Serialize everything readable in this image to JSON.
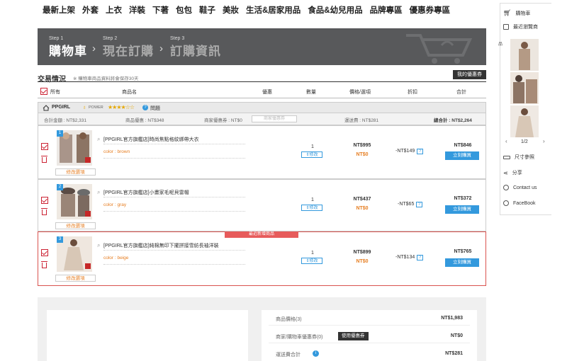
{
  "nav": [
    "最新上架",
    "外套",
    "上衣",
    "洋裝",
    "下著",
    "包包",
    "鞋子",
    "美妝",
    "生活&居家用品",
    "食品&幼兒用品",
    "品牌專區",
    "優惠券專區"
  ],
  "banner": {
    "step1_small": "Step 1",
    "step1": "購物車",
    "step2_small": "Step 2",
    "step2": "現在訂購",
    "step3_small": "Step 3",
    "step3": "訂購資訊",
    "arrow": "›"
  },
  "section": {
    "title": "交易情況",
    "note": "※ 購物車商品資料將會保存30天",
    "my_coupon": "我的優惠券"
  },
  "columns": {
    "all": "所有",
    "name": "商品名",
    "coupon": "優惠",
    "qty": "數量",
    "price": "價格/選項",
    "discount": "折扣",
    "total": "合計"
  },
  "shop": {
    "name": "PPGIRL",
    "power": "POWER",
    "stars": "★★★★☆☆",
    "question": "問題",
    "total_amount": "合計金額 : NT$2,331",
    "item_discount": "商品優惠 : NT$348",
    "shop_coupon": "商家優惠券 : NT$0",
    "coupon_placeholder": "商家優惠券",
    "shipping": "運送費 : NT$281",
    "grand_total": "總合計 : NT$2,264"
  },
  "items": [
    {
      "num": "1",
      "name": "[PPGIRL官方旗艦店]時尚焦點格紋綁帶大衣",
      "color": "color : brown",
      "qty": "1",
      "qty_btn": "⇕修改",
      "price": "NT$995",
      "price_opt": "NT$0",
      "discount": "-NT$149",
      "total": "NT$846",
      "buy": "立刻購買",
      "edit": "修改選項"
    },
    {
      "num": "2",
      "name": "[PPGIRL官方旗艦店]小畫家毛呢貝雷帽",
      "color": "color : gray",
      "qty": "1",
      "qty_btn": "⇕修改",
      "price": "NT$437",
      "price_opt": "NT$0",
      "discount": "-NT$65",
      "total": "NT$372",
      "buy": "立刻購買",
      "edit": "修改選項"
    },
    {
      "num": "3",
      "name": "[PPGIRL官方旗艦店]純棉無印下擺拼接雪紡長袖洋裝",
      "color": "color : beige",
      "qty": "1",
      "qty_btn": "⇕修改",
      "price": "NT$899",
      "price_opt": "NT$0",
      "discount": "-NT$134",
      "total": "NT$765",
      "buy": "立刻購買",
      "edit": "修改選項",
      "tag": "最近新增商品"
    }
  ],
  "summary": {
    "goods_label": "商品價格(3)",
    "goods_value": "NT$1,983",
    "coupon_label": "商家/購物車優惠券(0)",
    "coupon_btn": "使用優惠券",
    "coupon_value": "NT$0",
    "ship_label": "運送費合計",
    "ship_value": "NT$281"
  },
  "sidebar": {
    "cart": "購物車",
    "recent": "最近瀏覽商",
    "pager": "1/2",
    "prev": "‹",
    "next": "›",
    "size": "尺寸參照",
    "share": "分享",
    "contact": "Contact us",
    "facebook": "FaceBook",
    "edge_char": "品"
  }
}
